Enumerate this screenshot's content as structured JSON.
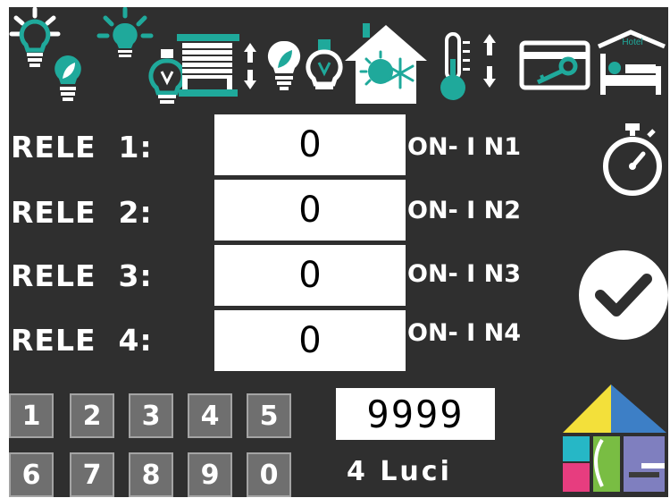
{
  "relays": [
    {
      "label": "RELE  1:",
      "value": "0",
      "mode": "ON- I N1"
    },
    {
      "label": "RELE  2:",
      "value": "0",
      "mode": "ON- I N2"
    },
    {
      "label": "RELE  3:",
      "value": "0",
      "mode": "ON- I N3"
    },
    {
      "label": "RELE  4:",
      "value": "0",
      "mode": "ON- I N4"
    }
  ],
  "keypad": [
    "1",
    "2",
    "3",
    "4",
    "5",
    "6",
    "7",
    "8",
    "9",
    "0"
  ],
  "code_display": "9999",
  "mode_label": "4  Luci",
  "hotel_sign": "Hotel",
  "colors": {
    "background": "#2f2f2f",
    "icon_teal": "#1fa99b",
    "icon_white": "#ffffff",
    "key_gray": "#6f6f6f",
    "logo_yellow": "#f3e03a",
    "logo_blue": "#3d7fc6",
    "logo_green": "#79bd43",
    "logo_cyan": "#26b7c6",
    "logo_pink": "#e73d7f",
    "logo_purple": "#7f7fbf"
  },
  "icons": [
    "lights-icon",
    "bulb-dimmer-icon",
    "shutter-icon",
    "eco-bulb-icon",
    "climate-icon",
    "thermostat-icon",
    "keycard-icon",
    "hotel-bed-icon",
    "timer-icon",
    "confirm-icon",
    "home-logo"
  ]
}
